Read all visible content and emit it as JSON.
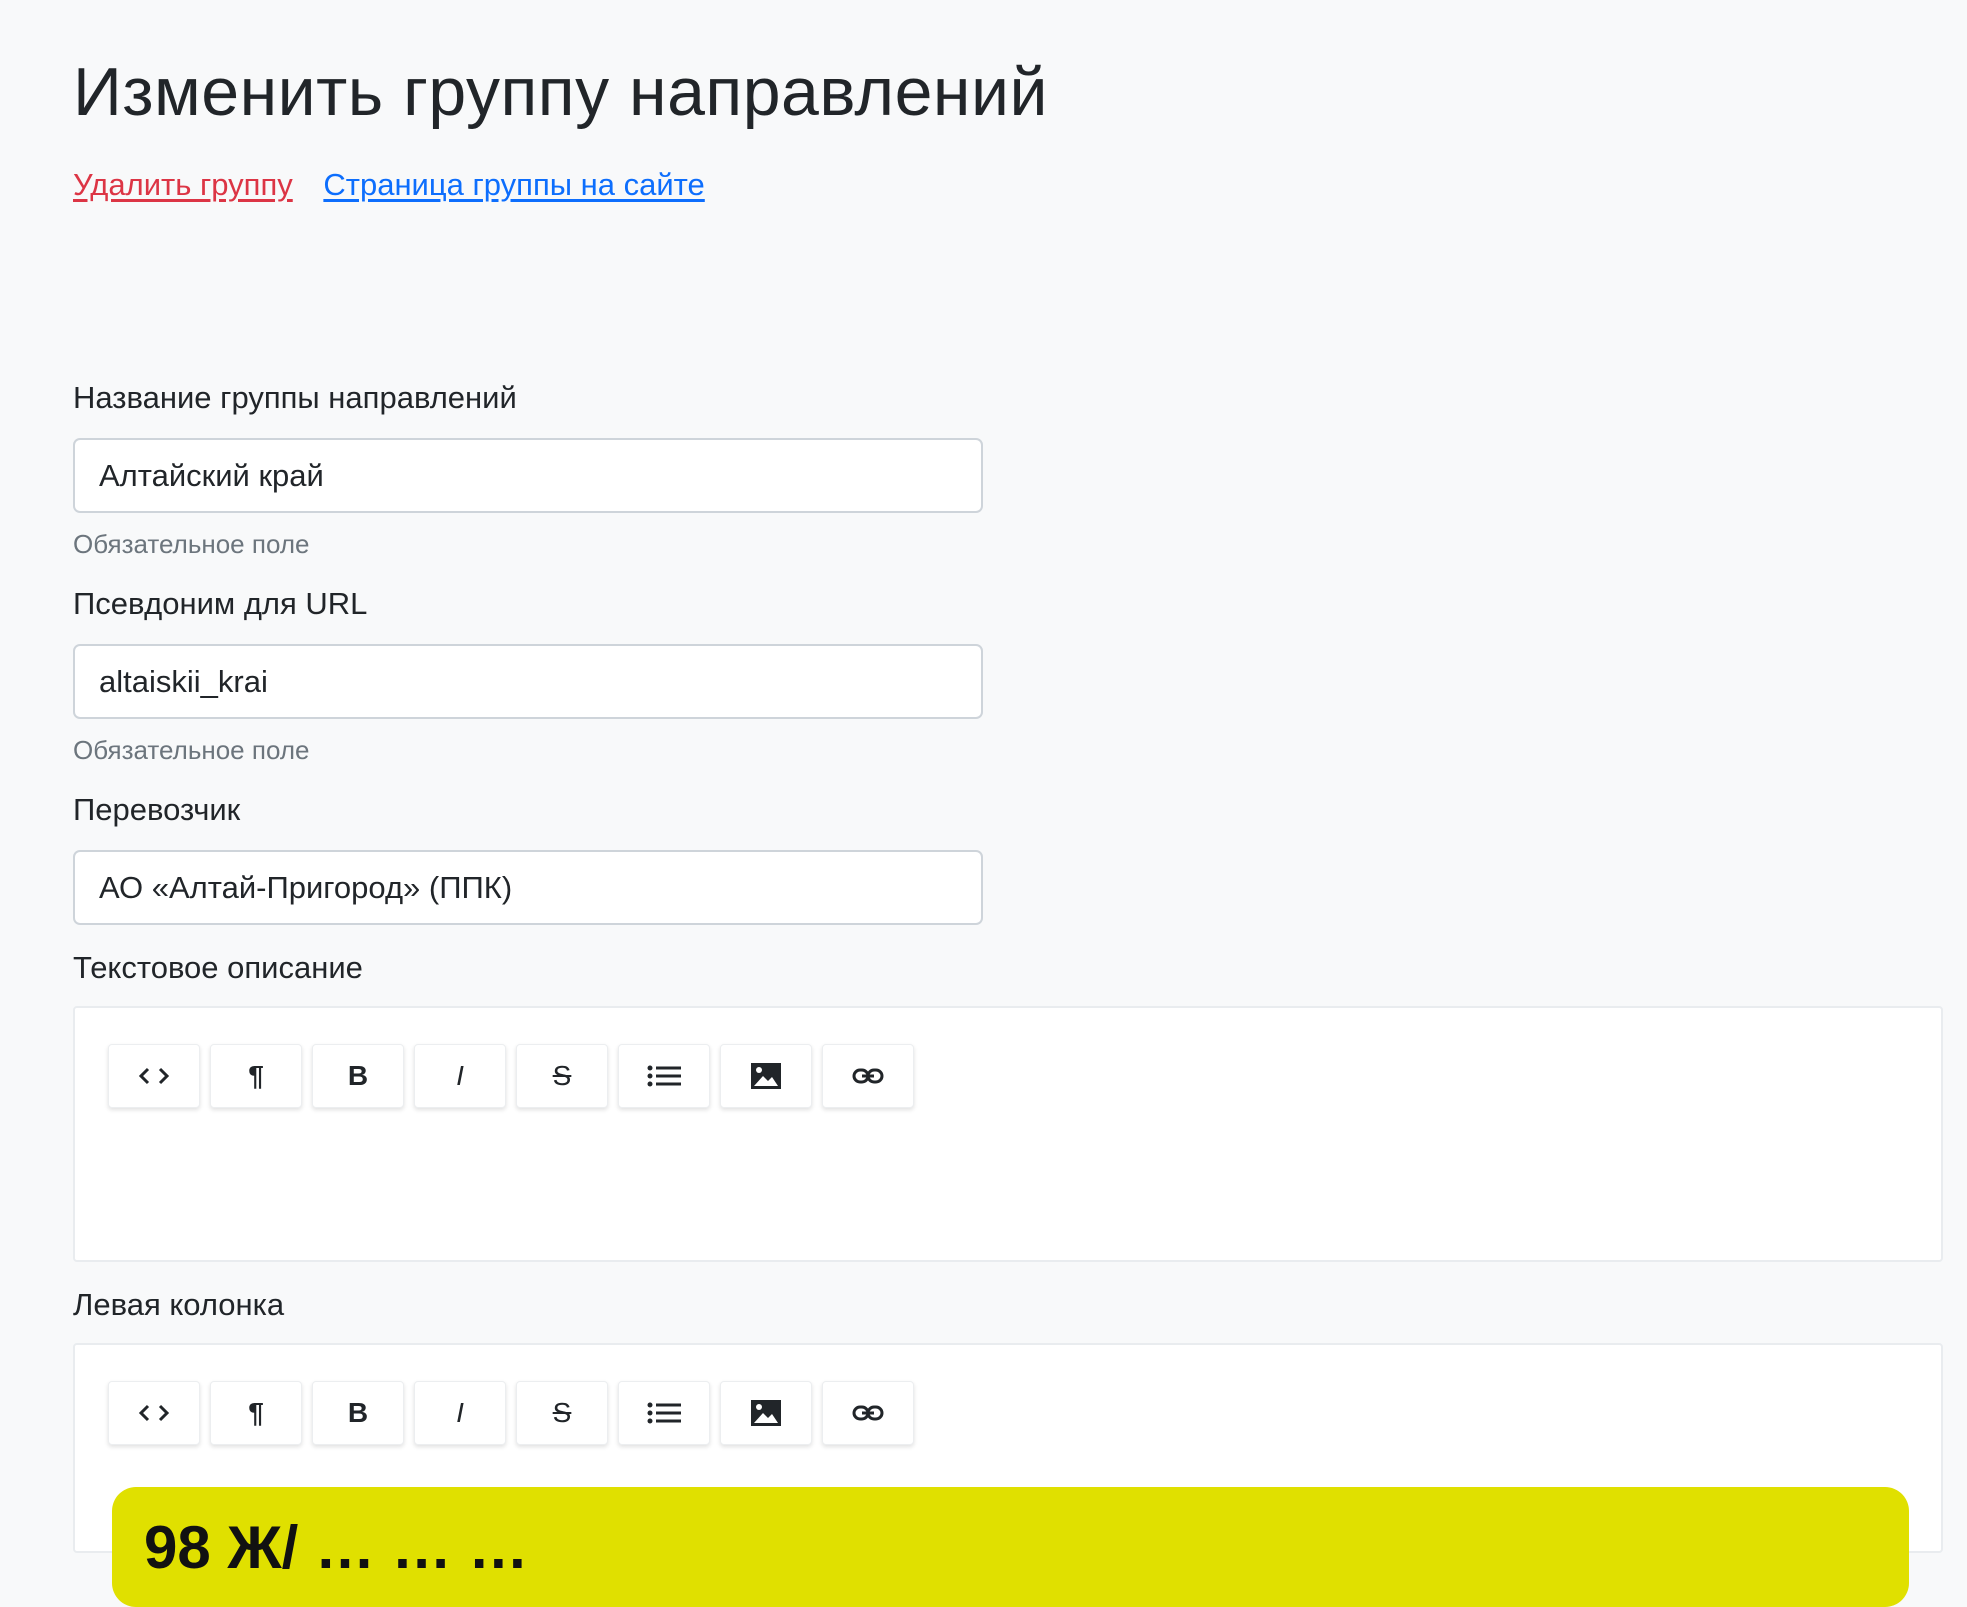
{
  "page": {
    "title": "Изменить группу направлений",
    "delete_link": "Удалить группу",
    "site_link": "Страница группы на сайте"
  },
  "form": {
    "name": {
      "label": "Название группы направлений",
      "value": "Алтайский край",
      "help": "Обязательное поле"
    },
    "alias": {
      "label": "Псевдоним для URL",
      "value": "altaiskii_krai",
      "help": "Обязательное поле"
    },
    "carrier": {
      "label": "Перевозчик",
      "value": "АО «Алтай-Пригород» (ППК)"
    },
    "description": {
      "label": "Текстовое описание"
    },
    "left_column": {
      "label": "Левая колонка",
      "banner_text": "98 Ж/ … … …"
    }
  },
  "toolbar": {
    "buttons": [
      {
        "name": "code-view-button",
        "icon": "code-icon",
        "glyph": "<>"
      },
      {
        "name": "paragraph-button",
        "icon": "paragraph-icon",
        "glyph": "¶"
      },
      {
        "name": "bold-button",
        "icon": "bold-icon",
        "glyph": "B"
      },
      {
        "name": "italic-button",
        "icon": "italic-icon",
        "glyph": "I"
      },
      {
        "name": "strikethrough-button",
        "icon": "strikethrough-icon",
        "glyph": "S"
      },
      {
        "name": "list-button",
        "icon": "list-icon",
        "glyph": "list"
      },
      {
        "name": "image-button",
        "icon": "image-icon",
        "glyph": "image"
      },
      {
        "name": "link-button",
        "icon": "link-icon",
        "glyph": "link"
      }
    ]
  },
  "colors": {
    "background": "#f8f9fa",
    "danger": "#dc3545",
    "primary": "#0d6efd",
    "banner": "#e0e000"
  }
}
